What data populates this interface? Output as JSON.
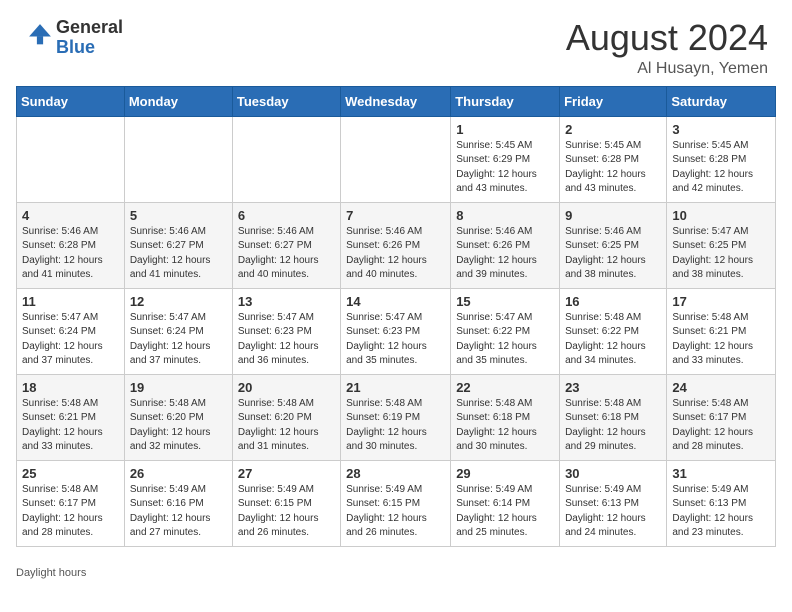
{
  "header": {
    "logo_general": "General",
    "logo_blue": "Blue",
    "month_year": "August 2024",
    "location": "Al Husayn, Yemen"
  },
  "days_of_week": [
    "Sunday",
    "Monday",
    "Tuesday",
    "Wednesday",
    "Thursday",
    "Friday",
    "Saturday"
  ],
  "weeks": [
    [
      {
        "day": "",
        "info": ""
      },
      {
        "day": "",
        "info": ""
      },
      {
        "day": "",
        "info": ""
      },
      {
        "day": "",
        "info": ""
      },
      {
        "day": "1",
        "info": "Sunrise: 5:45 AM\nSunset: 6:29 PM\nDaylight: 12 hours\nand 43 minutes."
      },
      {
        "day": "2",
        "info": "Sunrise: 5:45 AM\nSunset: 6:28 PM\nDaylight: 12 hours\nand 43 minutes."
      },
      {
        "day": "3",
        "info": "Sunrise: 5:45 AM\nSunset: 6:28 PM\nDaylight: 12 hours\nand 42 minutes."
      }
    ],
    [
      {
        "day": "4",
        "info": "Sunrise: 5:46 AM\nSunset: 6:28 PM\nDaylight: 12 hours\nand 41 minutes."
      },
      {
        "day": "5",
        "info": "Sunrise: 5:46 AM\nSunset: 6:27 PM\nDaylight: 12 hours\nand 41 minutes."
      },
      {
        "day": "6",
        "info": "Sunrise: 5:46 AM\nSunset: 6:27 PM\nDaylight: 12 hours\nand 40 minutes."
      },
      {
        "day": "7",
        "info": "Sunrise: 5:46 AM\nSunset: 6:26 PM\nDaylight: 12 hours\nand 40 minutes."
      },
      {
        "day": "8",
        "info": "Sunrise: 5:46 AM\nSunset: 6:26 PM\nDaylight: 12 hours\nand 39 minutes."
      },
      {
        "day": "9",
        "info": "Sunrise: 5:46 AM\nSunset: 6:25 PM\nDaylight: 12 hours\nand 38 minutes."
      },
      {
        "day": "10",
        "info": "Sunrise: 5:47 AM\nSunset: 6:25 PM\nDaylight: 12 hours\nand 38 minutes."
      }
    ],
    [
      {
        "day": "11",
        "info": "Sunrise: 5:47 AM\nSunset: 6:24 PM\nDaylight: 12 hours\nand 37 minutes."
      },
      {
        "day": "12",
        "info": "Sunrise: 5:47 AM\nSunset: 6:24 PM\nDaylight: 12 hours\nand 37 minutes."
      },
      {
        "day": "13",
        "info": "Sunrise: 5:47 AM\nSunset: 6:23 PM\nDaylight: 12 hours\nand 36 minutes."
      },
      {
        "day": "14",
        "info": "Sunrise: 5:47 AM\nSunset: 6:23 PM\nDaylight: 12 hours\nand 35 minutes."
      },
      {
        "day": "15",
        "info": "Sunrise: 5:47 AM\nSunset: 6:22 PM\nDaylight: 12 hours\nand 35 minutes."
      },
      {
        "day": "16",
        "info": "Sunrise: 5:48 AM\nSunset: 6:22 PM\nDaylight: 12 hours\nand 34 minutes."
      },
      {
        "day": "17",
        "info": "Sunrise: 5:48 AM\nSunset: 6:21 PM\nDaylight: 12 hours\nand 33 minutes."
      }
    ],
    [
      {
        "day": "18",
        "info": "Sunrise: 5:48 AM\nSunset: 6:21 PM\nDaylight: 12 hours\nand 33 minutes."
      },
      {
        "day": "19",
        "info": "Sunrise: 5:48 AM\nSunset: 6:20 PM\nDaylight: 12 hours\nand 32 minutes."
      },
      {
        "day": "20",
        "info": "Sunrise: 5:48 AM\nSunset: 6:20 PM\nDaylight: 12 hours\nand 31 minutes."
      },
      {
        "day": "21",
        "info": "Sunrise: 5:48 AM\nSunset: 6:19 PM\nDaylight: 12 hours\nand 30 minutes."
      },
      {
        "day": "22",
        "info": "Sunrise: 5:48 AM\nSunset: 6:18 PM\nDaylight: 12 hours\nand 30 minutes."
      },
      {
        "day": "23",
        "info": "Sunrise: 5:48 AM\nSunset: 6:18 PM\nDaylight: 12 hours\nand 29 minutes."
      },
      {
        "day": "24",
        "info": "Sunrise: 5:48 AM\nSunset: 6:17 PM\nDaylight: 12 hours\nand 28 minutes."
      }
    ],
    [
      {
        "day": "25",
        "info": "Sunrise: 5:48 AM\nSunset: 6:17 PM\nDaylight: 12 hours\nand 28 minutes."
      },
      {
        "day": "26",
        "info": "Sunrise: 5:49 AM\nSunset: 6:16 PM\nDaylight: 12 hours\nand 27 minutes."
      },
      {
        "day": "27",
        "info": "Sunrise: 5:49 AM\nSunset: 6:15 PM\nDaylight: 12 hours\nand 26 minutes."
      },
      {
        "day": "28",
        "info": "Sunrise: 5:49 AM\nSunset: 6:15 PM\nDaylight: 12 hours\nand 26 minutes."
      },
      {
        "day": "29",
        "info": "Sunrise: 5:49 AM\nSunset: 6:14 PM\nDaylight: 12 hours\nand 25 minutes."
      },
      {
        "day": "30",
        "info": "Sunrise: 5:49 AM\nSunset: 6:13 PM\nDaylight: 12 hours\nand 24 minutes."
      },
      {
        "day": "31",
        "info": "Sunrise: 5:49 AM\nSunset: 6:13 PM\nDaylight: 12 hours\nand 23 minutes."
      }
    ]
  ],
  "footer": {
    "note": "Daylight hours"
  }
}
